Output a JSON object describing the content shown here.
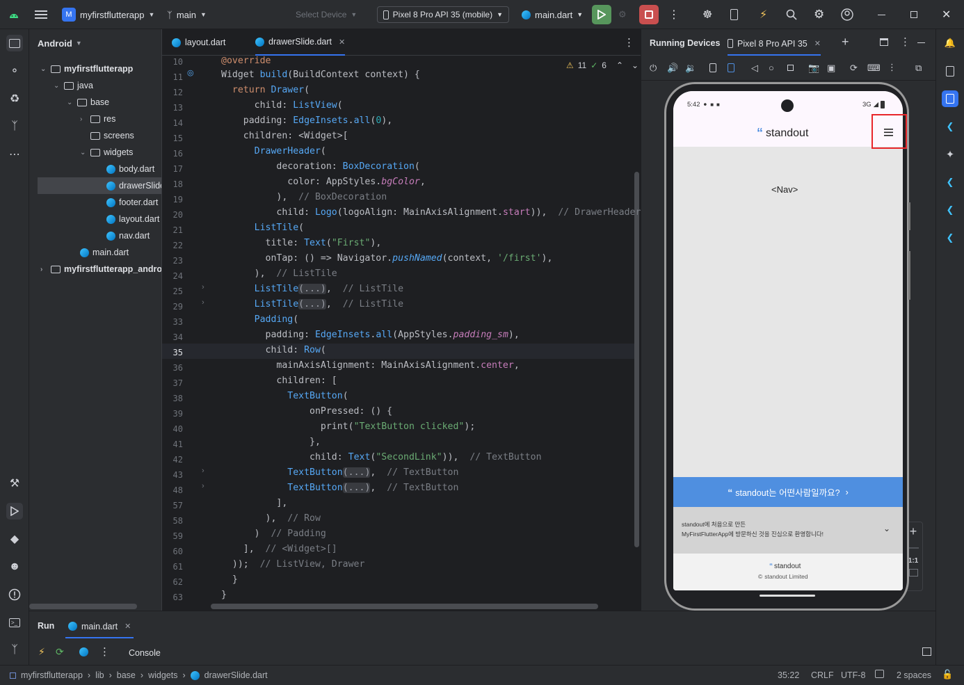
{
  "titlebar": {
    "project": "myfirstflutterapp",
    "project_initial": "M",
    "branch": "main",
    "select_device": "Select Device",
    "device": "Pixel 8 Pro API 35 (mobile)",
    "run_config": "main.dart"
  },
  "project_panel": {
    "view": "Android",
    "tree": [
      {
        "label": "myfirstflutterapp",
        "bold": true
      },
      {
        "label": "java"
      },
      {
        "label": "base"
      },
      {
        "label": "res"
      },
      {
        "label": "screens"
      },
      {
        "label": "widgets"
      },
      {
        "label": "body.dart"
      },
      {
        "label": "drawerSlide"
      },
      {
        "label": "footer.dart"
      },
      {
        "label": "layout.dart"
      },
      {
        "label": "nav.dart"
      },
      {
        "label": "main.dart"
      },
      {
        "label": "myfirstflutterapp_andro",
        "bold": true
      }
    ]
  },
  "editor": {
    "tabs": [
      "layout.dart",
      "drawerSlide.dart"
    ],
    "active_tab": "drawerSlide.dart",
    "warnings": "11",
    "checks": "6",
    "lines": [
      "10",
      "11",
      "12",
      "13",
      "14",
      "15",
      "16",
      "17",
      "18",
      "19",
      "20",
      "21",
      "22",
      "23",
      "24",
      "25",
      "29",
      "33",
      "34",
      "35",
      "36",
      "37",
      "38",
      "39",
      "40",
      "41",
      "42",
      "43",
      "48",
      "57",
      "58",
      "59",
      "60",
      "61",
      "62",
      "63"
    ],
    "current_line": "35"
  },
  "devices_panel": {
    "title": "Running Devices",
    "device_tab": "Pixel 8 Pro API 35"
  },
  "phone": {
    "time": "5:42",
    "network": "3G",
    "app_logo": "standout",
    "nav_placeholder": "<Nav>",
    "banner": "standout는 어떤사람일까요?",
    "accordion_line1": "standout에 처음으로 만든",
    "accordion_line2": "MyFirstFlutterApp에 방문하신 것을 진심으로 환영합니다!",
    "footer_logo": "standout",
    "footer_copy": "standout Limited"
  },
  "zoom": {
    "ratio": "1:1"
  },
  "bottom_panel": {
    "tab_run": "Run",
    "tab_config": "main.dart",
    "console": "Console"
  },
  "statusbar": {
    "crumbs": [
      "myfirstflutterapp",
      "lib",
      "base",
      "widgets",
      "drawerSlide.dart"
    ],
    "position": "35:22",
    "line_sep": "CRLF",
    "encoding": "UTF-8",
    "indent": "2 spaces"
  },
  "colors": {
    "accent": "#3574f0",
    "run": "#57965c",
    "stop": "#c94f4f",
    "banner": "#4f8fe0"
  }
}
